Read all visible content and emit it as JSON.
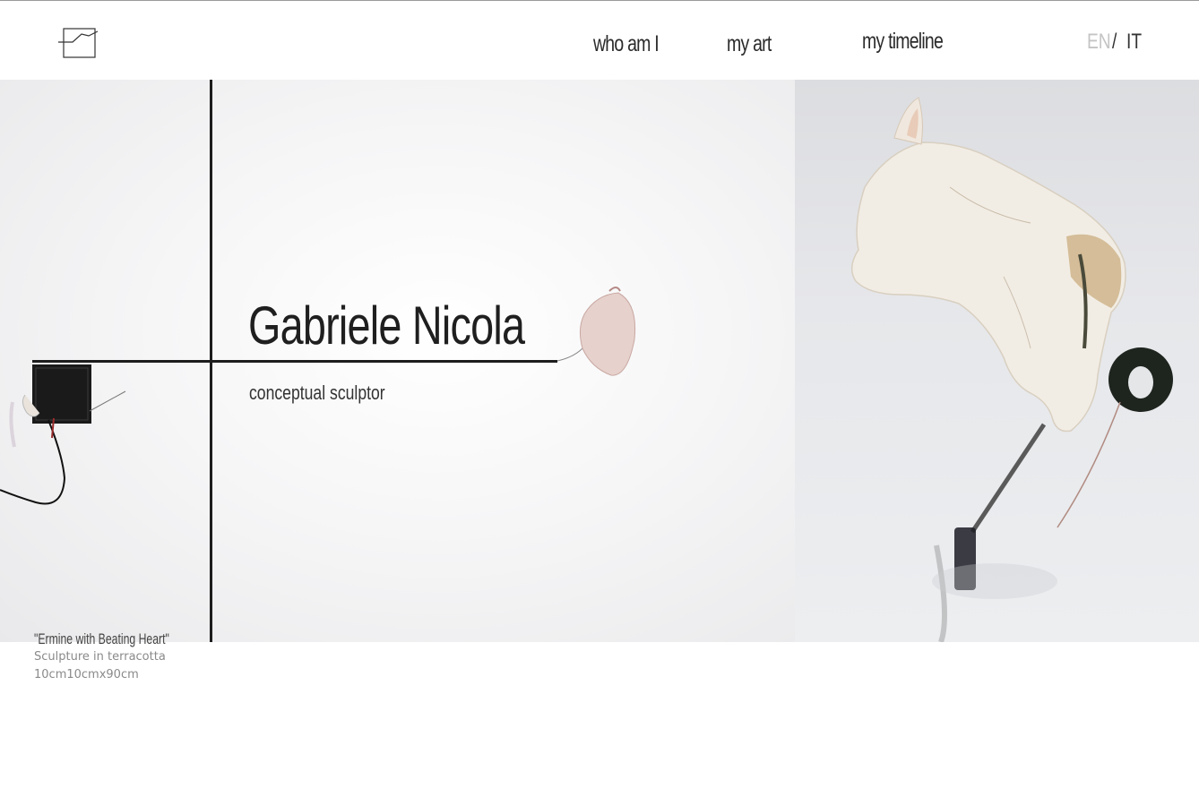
{
  "header": {
    "logo_icon": "graph-line-logo-icon",
    "nav": {
      "who_am_i": "who am I",
      "my_art": "my art",
      "my_timeline": "my timeline"
    },
    "lang": {
      "en": "EN",
      "separator": "/",
      "it": "IT"
    }
  },
  "hero": {
    "title": "Gabriele Nicola",
    "subtitle": "conceptual sculptor"
  },
  "caption": {
    "title": "\"Ermine with Beating Heart\"",
    "medium": "Sculpture in terracotta",
    "dimensions": "10cm10cmx90cm"
  },
  "colors": {
    "text_dark": "#222222",
    "lang_inactive": "#c4c4c4",
    "caption_gray": "#8a8a8a"
  }
}
